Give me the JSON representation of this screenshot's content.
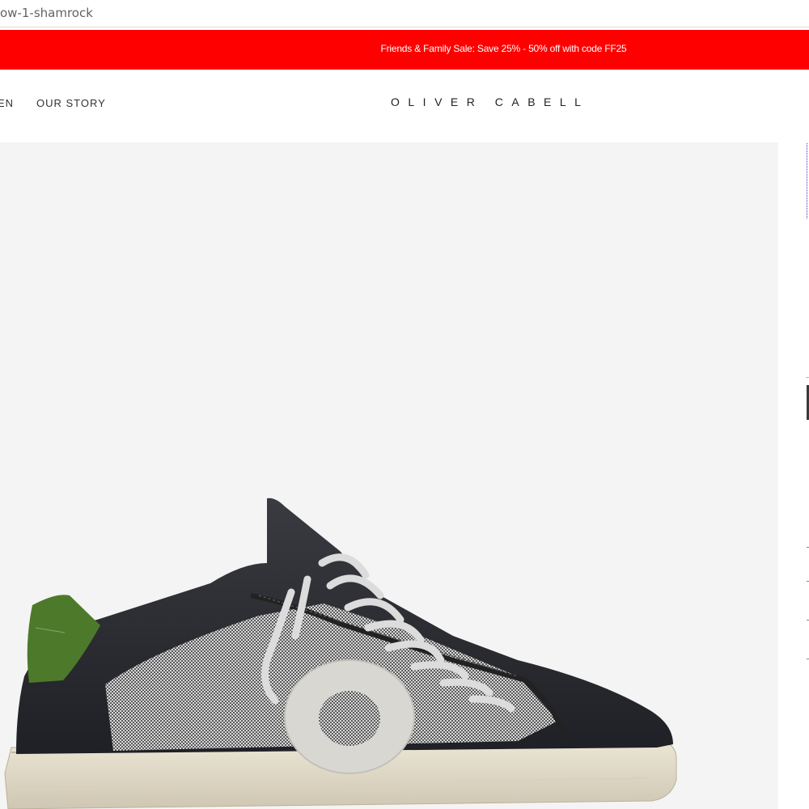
{
  "browser": {
    "url_fragment": "ow-1-shamrock"
  },
  "promo": {
    "text": "Friends & Family Sale: Save 25% - 50% off with code FF25",
    "background": "#ff0000"
  },
  "nav": {
    "items": [
      {
        "label": "EN"
      },
      {
        "label": "OUR STORY"
      }
    ]
  },
  "brand": {
    "logo": "OLIVER CABELL"
  },
  "product": {
    "image_alt": "Low 1 sneaker in shamrock colorway",
    "colors": {
      "upper": "#2b2c31",
      "heel_tab": "#4d7a2a",
      "mesh": "#9a9a9a",
      "sole": "#e3dccb",
      "laces": "#dedede",
      "background": "#f4f4f4"
    }
  }
}
